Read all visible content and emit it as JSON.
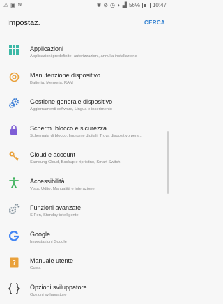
{
  "status": {
    "battery": "56%",
    "time": "10:47"
  },
  "header": {
    "title": "Impostaz.",
    "search_label": "CERCA"
  },
  "items": [
    {
      "title": "Applicazioni",
      "subtitle": "Applicazioni predefinite, autorizzazioni, annulla installazione",
      "icon": "apps-grid-icon",
      "color": "#3db8a6"
    },
    {
      "title": "Manutenzione dispositivo",
      "subtitle": "Batteria, Memoria, RAM",
      "icon": "device-maintenance-icon",
      "color": "#e9a13b"
    },
    {
      "title": "Gestione generale dispositivo",
      "subtitle": "Aggiornamenti software, Lingua e inserimento",
      "icon": "gears-icon",
      "color": "#3e7fd6"
    },
    {
      "title": "Scherm. blocco e sicurezza",
      "subtitle": "Schermata di blocco, Impronte digitali, Trova dispositivo pers...",
      "icon": "lock-icon",
      "color": "#7e5ed6"
    },
    {
      "title": "Cloud e account",
      "subtitle": "Samsung Cloud, Backup e ripristino, Smart Switch",
      "icon": "key-icon",
      "color": "#e9a13b"
    },
    {
      "title": "Accessibilità",
      "subtitle": "Vista, Udito, Manualità e interazione",
      "icon": "accessibility-icon",
      "color": "#3fb25d"
    },
    {
      "title": "Funzioni avanzate",
      "subtitle": "S Pen, Standby intelligente",
      "icon": "advanced-gears-icon",
      "color": "#7a8a96"
    },
    {
      "title": "Google",
      "subtitle": "Impostazioni Google",
      "icon": "google-icon",
      "color": "#4285f4"
    },
    {
      "title": "Manuale utente",
      "subtitle": "Guida",
      "icon": "manual-icon",
      "color": "#e9a13b"
    },
    {
      "title": "Opzioni sviluppatore",
      "subtitle": "Opzioni sviluppatore",
      "icon": "developer-braces-icon",
      "color": "#444444"
    }
  ]
}
